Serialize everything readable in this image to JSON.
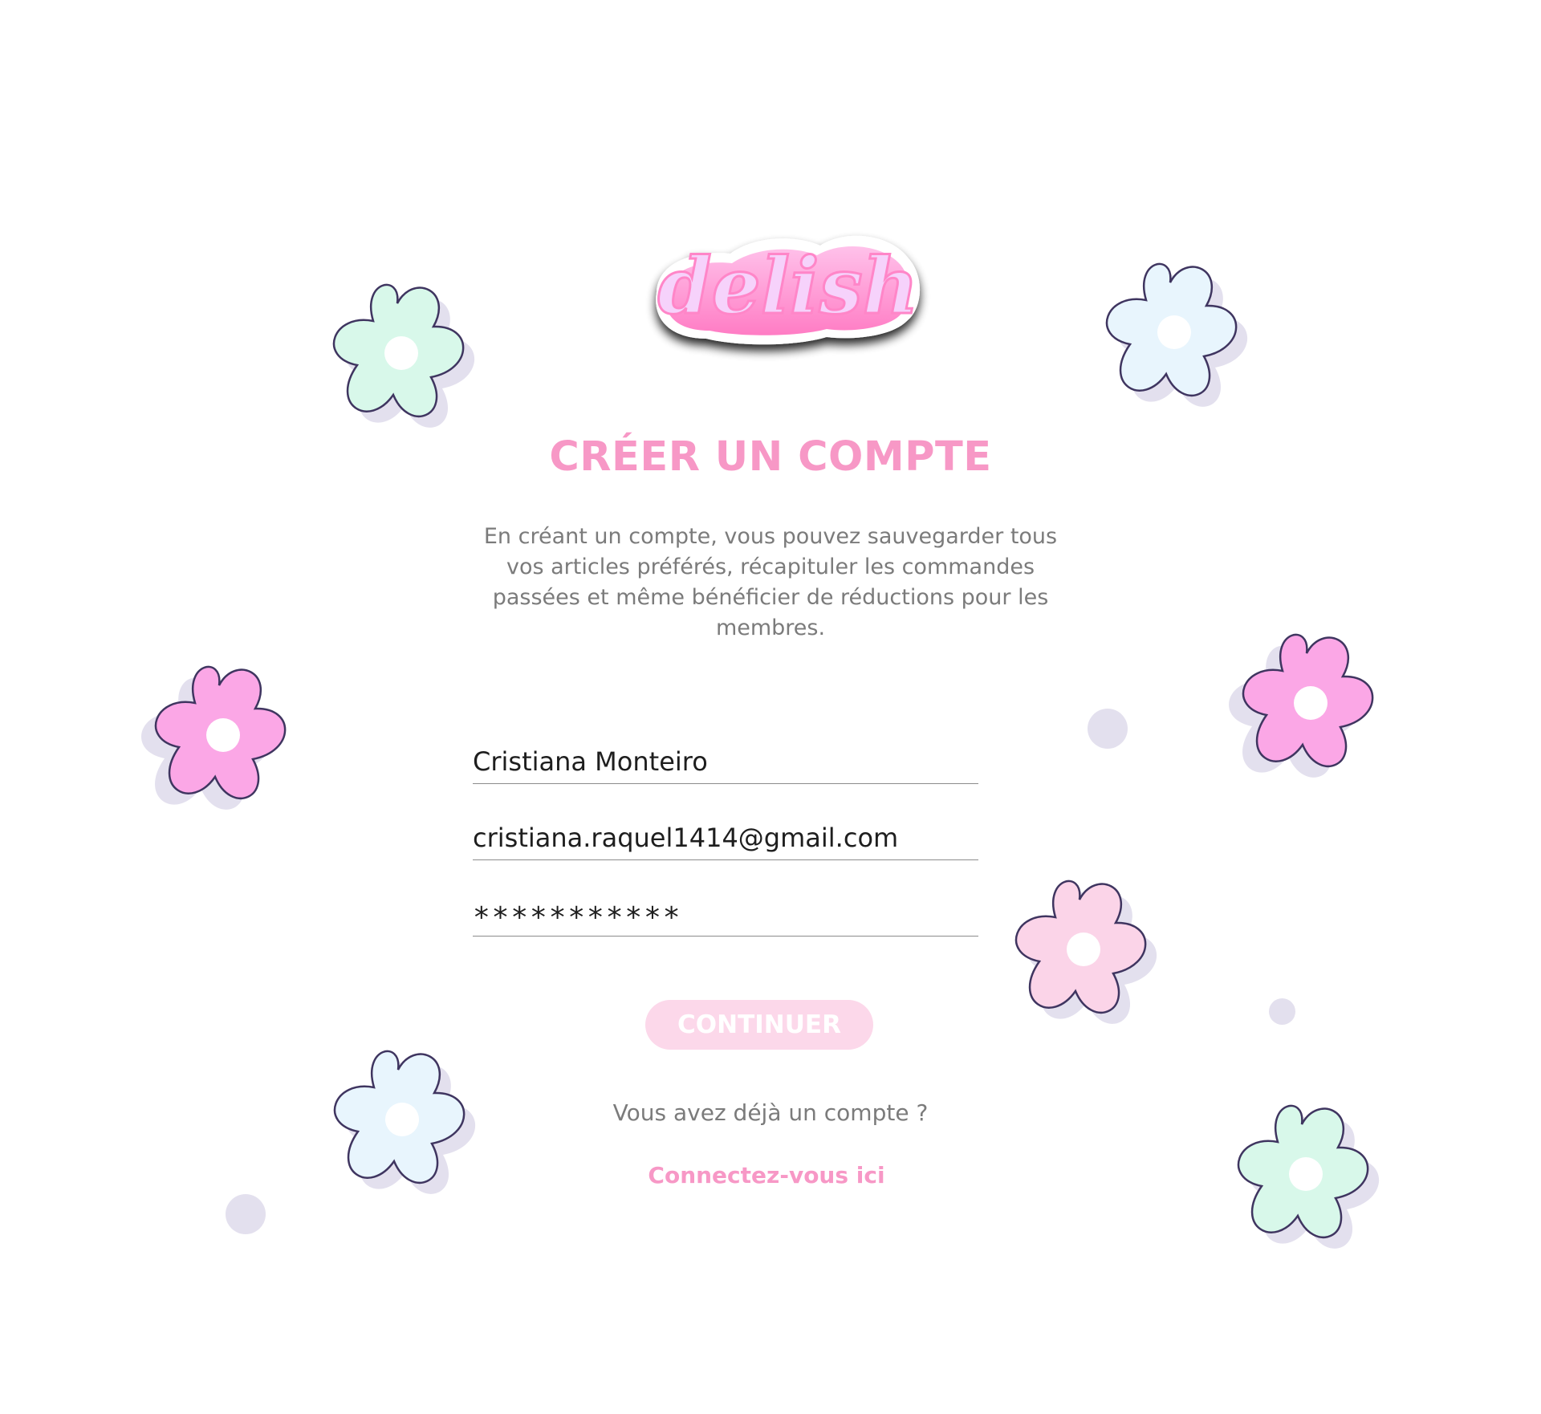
{
  "brand": {
    "logo_text": "delish",
    "logo_icon": "delish-logo"
  },
  "signup": {
    "title": "CRÉER UN COMPTE",
    "intro": "En créant un compte, vous pouvez sauvegarder tous vos articles préférés, récapituler les commandes passées et même bénéficier de réductions pour les membres.",
    "name_value": "Cristiana Monteiro",
    "email_value": "cristiana.raquel1414@gmail.com",
    "password_value": "***********",
    "continue_label": "CONTINUER",
    "have_account_text": "Vous avez déjà un compte ?",
    "login_link_label": "Connectez-vous ici"
  },
  "decorations": {
    "flower_icon": "flower-icon",
    "colors": {
      "mint": "#d8f8ea",
      "light_blue": "#e8f5fd",
      "pink": "#fba7e6",
      "light_pink": "#fbd4e8",
      "shadow": "#e3e0ee",
      "outline": "#3f3560"
    }
  },
  "colors": {
    "accent_pink": "#f798c6",
    "button_pink": "#fcd8ea",
    "text_gray": "#7b7b7b"
  }
}
